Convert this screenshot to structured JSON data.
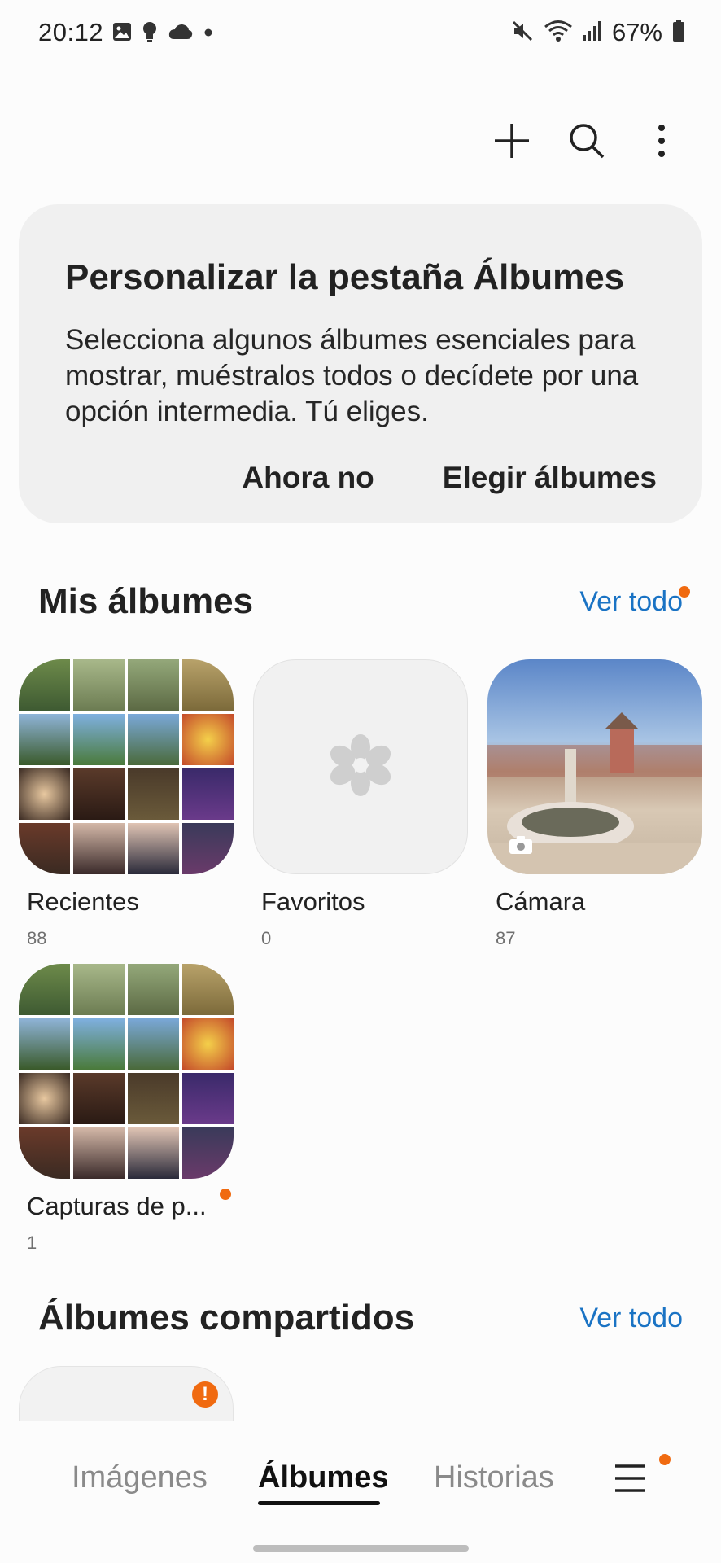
{
  "status_bar": {
    "time": "20:12",
    "battery": "67%",
    "left_icons": [
      "gallery-icon",
      "bulb-icon",
      "cloud-icon",
      "dot-icon"
    ],
    "right_icons": [
      "mute-icon",
      "wifi-icon",
      "signal-icon",
      "battery-icon"
    ]
  },
  "toolbar": {
    "add_icon": "plus-icon",
    "search_icon": "search-icon",
    "more_icon": "more-vertical-icon"
  },
  "promo": {
    "title": "Personalizar la pestaña Álbumes",
    "text": "Selecciona algunos álbumes esenciales para mostrar, muéstralos todos o decídete por una opción intermedia. Tú eliges.",
    "dismiss_label": "Ahora no",
    "choose_label": "Elegir álbumes"
  },
  "my_albums": {
    "title": "Mis álbumes",
    "see_all": "Ver todo",
    "albums": [
      {
        "name": "Recientes",
        "count": "88"
      },
      {
        "name": "Favoritos",
        "count": "0"
      },
      {
        "name": "Cámara",
        "count": "87"
      },
      {
        "name": "Capturas de p...",
        "count": "1"
      }
    ]
  },
  "shared_albums": {
    "title": "Álbumes compartidos",
    "see_all": "Ver todo"
  },
  "bottom_nav": {
    "tabs": [
      {
        "label": "Imágenes",
        "active": false
      },
      {
        "label": "Álbumes",
        "active": true
      },
      {
        "label": "Historias",
        "active": false
      }
    ],
    "menu_icon": "hamburger-menu-icon"
  },
  "colors": {
    "accent_link": "#1a73c4",
    "badge": "#f06a10",
    "card_bg": "#f0f0f0"
  }
}
